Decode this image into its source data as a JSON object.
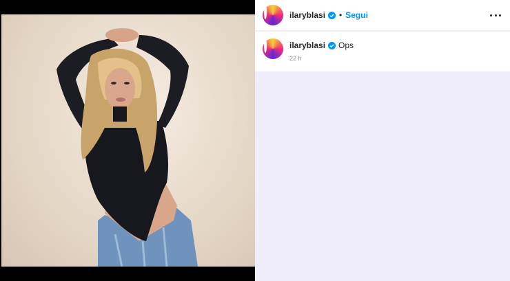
{
  "post": {
    "username": "ilaryblasi",
    "follow_label": "Segui",
    "separator": "•",
    "caption": "Ops",
    "time_ago": "22 h",
    "verified_color": "#0095f6"
  },
  "icons": {
    "verified": "verified-badge-icon",
    "more": "more-options-icon"
  }
}
